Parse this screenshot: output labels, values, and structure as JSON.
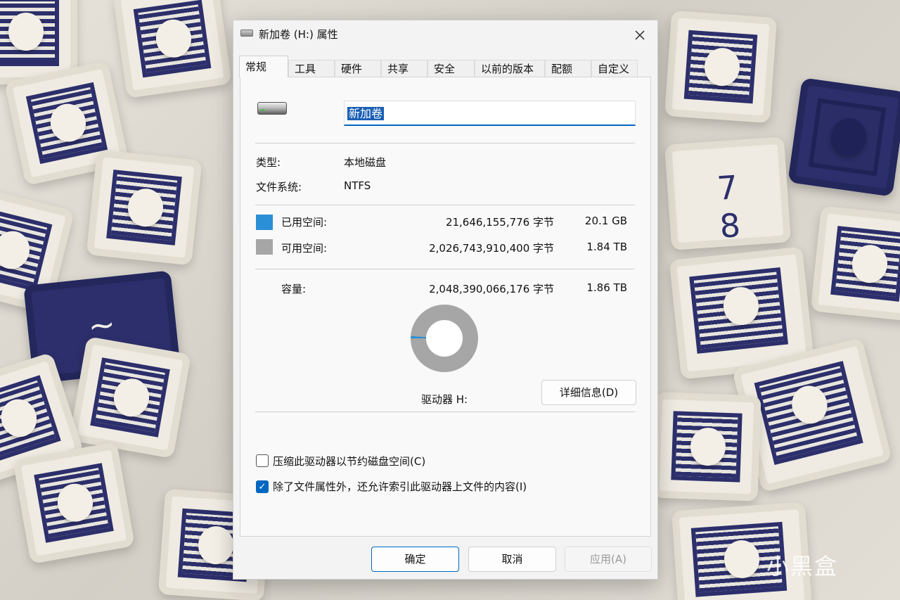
{
  "window": {
    "title": "新加卷 (H:) 属性",
    "close_icon": "close-icon"
  },
  "tabs": [
    "常规",
    "工具",
    "硬件",
    "共享",
    "安全",
    "以前的版本",
    "配额",
    "自定义"
  ],
  "general": {
    "volume_name": "新加卷",
    "type_label": "类型:",
    "type_value": "本地磁盘",
    "fs_label": "文件系统:",
    "fs_value": "NTFS",
    "used": {
      "label": "已用空间:",
      "bytes": "21,646,155,776 字节",
      "size": "20.1 GB",
      "color": "#2b8fd6"
    },
    "free": {
      "label": "可用空间:",
      "bytes": "2,026,743,910,400 字节",
      "size": "1.84 TB",
      "color": "#a6a6a6"
    },
    "capacity": {
      "label": "容量:",
      "bytes": "2,048,390,066,176 字节",
      "size": "1.86 TB"
    },
    "used_fraction": 0.0106,
    "drive_label": "驱动器 H:",
    "details_button": "详细信息(D)",
    "compress_label": "压缩此驱动器以节约磁盘空间(C)",
    "compress_checked": false,
    "index_label": "除了文件属性外，还允许索引此驱动器上文件的内容(I)",
    "index_checked": true
  },
  "footer": {
    "ok": "确定",
    "cancel": "取消",
    "apply": "应用(A)"
  },
  "watermark": "小黑盒",
  "colors": {
    "accent": "#0067c0",
    "used": "#2b8fd6",
    "free": "#a6a6a6"
  }
}
